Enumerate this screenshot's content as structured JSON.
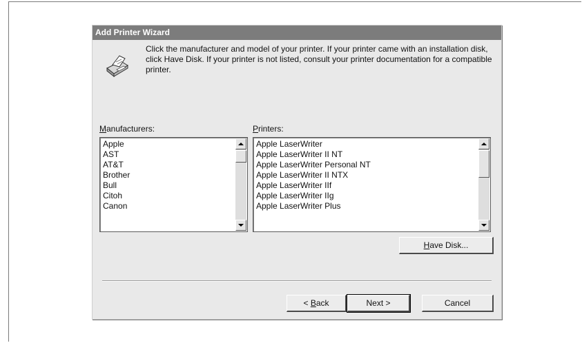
{
  "dialog": {
    "title": "Add Printer Wizard",
    "instruction": "Click the manufacturer and model of your printer. If your printer came with an installation disk, click Have Disk. If your printer is not listed, consult your printer documentation for a compatible printer."
  },
  "manufacturers": {
    "label_accel": "M",
    "label_rest": "anufacturers:",
    "items": [
      "Apple",
      "AST",
      "AT&T",
      "Brother",
      "Bull",
      "Citoh",
      "Canon"
    ],
    "selected": "Apple"
  },
  "printers": {
    "label_accel": "P",
    "label_rest": "rinters:",
    "items": [
      "Apple LaserWriter",
      "Apple LaserWriter II NT",
      "Apple LaserWriter Personal NT",
      "Apple LaserWriter II NTX",
      "Apple LaserWriter IIf",
      "Apple LaserWriter IIg",
      "Apple LaserWriter Plus"
    ],
    "selected": "Apple LaserWriter"
  },
  "buttons": {
    "have_disk_accel": "H",
    "have_disk_rest": "ave Disk...",
    "back_prefix": "< ",
    "back_accel": "B",
    "back_rest": "ack",
    "next": "Next >",
    "cancel": "Cancel"
  },
  "icons": {
    "printer": "printer-icon",
    "scroll_up": "arrow-up-icon",
    "scroll_down": "arrow-down-icon"
  },
  "colors": {
    "titlebar": "#7c7c7c",
    "selection": "#6f6f6f",
    "dialog_bg": "#e9e9e9"
  }
}
